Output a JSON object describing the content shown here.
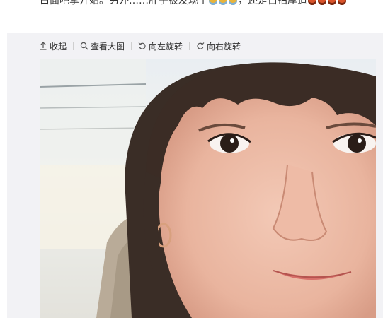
{
  "post": {
    "text_part1": "白面吧掌开始。另外……胖子被发现了",
    "text_part2": "，还是自拍厚道"
  },
  "toolbar": {
    "collapse_label": "收起",
    "view_large_label": "查看大图",
    "rotate_left_label": "向左旋转",
    "rotate_right_label": "向右旋转"
  },
  "icons": {
    "collapse": "arrow-up-icon",
    "view_large": "magnifier-icon",
    "rotate_left": "rotate-left-icon",
    "rotate_right": "rotate-right-icon"
  },
  "colors": {
    "toolbar_bg": "#f2f2f5",
    "text": "#333333"
  }
}
